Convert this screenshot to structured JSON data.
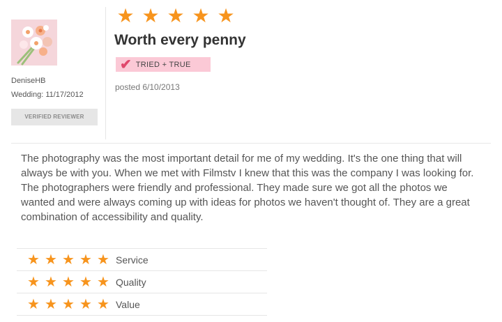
{
  "reviewer": {
    "name": "DeniseHB",
    "wedding_date": "Wedding: 11/17/2012",
    "verified_label": "VERIFIED REVIEWER"
  },
  "review": {
    "rating": 5,
    "title": "Worth every penny",
    "badge_label": "TRIED + TRUE",
    "posted": "posted 6/10/2013",
    "body": "The photography was the most important detail for me of my wedding. It's the one thing that will always be with you. When we met with Filmstv I knew that this was the company I was looking for. The photographers were friendly and professional. They made sure we got all the photos we wanted and were always coming up with ideas for photos we haven't thought of. They are a great combination of accessibility and quality."
  },
  "ratings": [
    {
      "label": "Service",
      "stars": 5
    },
    {
      "label": "Quality",
      "stars": 5
    },
    {
      "label": "Value",
      "stars": 5
    }
  ],
  "colors": {
    "star": "#f7941d",
    "badge_bg": "#fbc9d6",
    "badge_check": "#e0486c"
  },
  "icons": {
    "star": "star-icon",
    "badge_check": "checkmark-icon"
  }
}
